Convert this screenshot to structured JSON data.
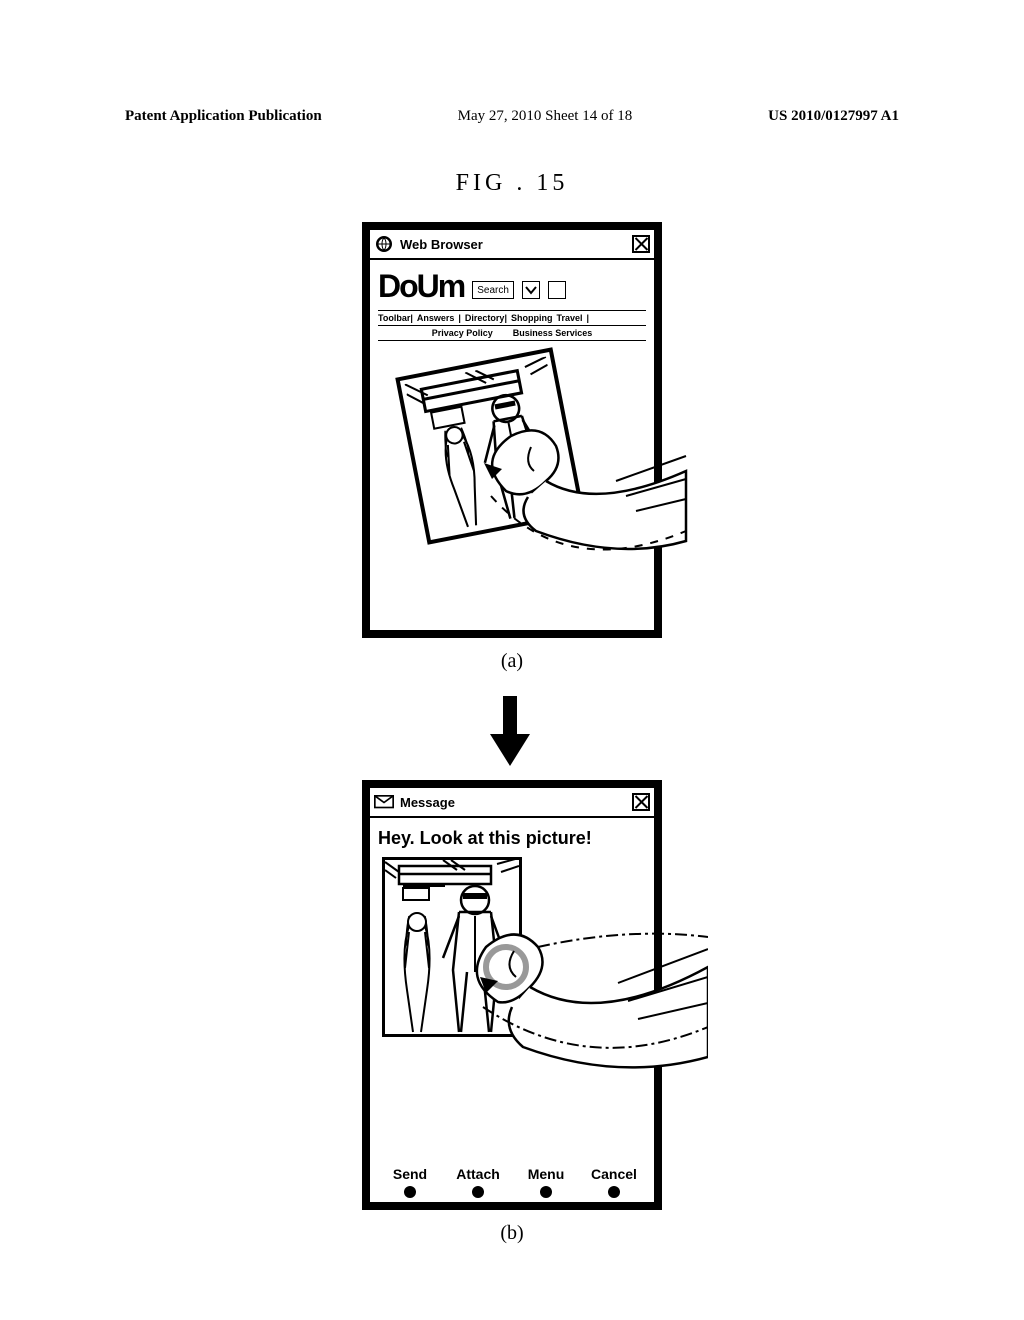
{
  "header": {
    "left": "Patent Application Publication",
    "mid": "May 27, 2010  Sheet 14 of 18",
    "right": "US 2010/0127997 A1"
  },
  "figure_title": "FIG . 15",
  "panel_a": {
    "app_title": "Web Browser",
    "logo_text": "DoUm",
    "search_label": "Search",
    "nav1": [
      "Toolbar|",
      "Answers",
      "|",
      "Directory|",
      "Shopping",
      "Travel",
      "|"
    ],
    "nav2": [
      "Privacy Policy",
      "Business Services"
    ],
    "caption": "(a)"
  },
  "panel_b": {
    "app_title": "Message",
    "body_text": "Hey. Look at this picture!",
    "softkeys": [
      "Send",
      "Attach",
      "Menu",
      "Cancel"
    ],
    "caption": "(b)"
  }
}
